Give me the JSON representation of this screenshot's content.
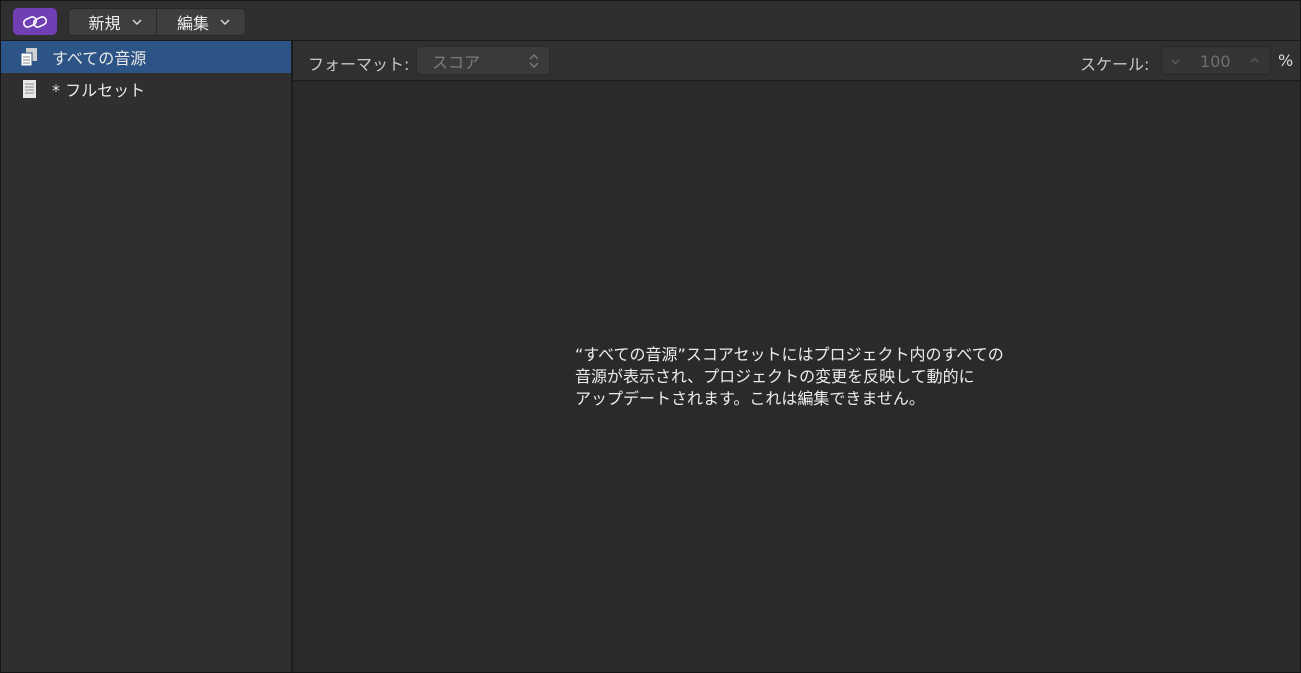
{
  "toolbar": {
    "link_icon": "link-icon",
    "new_label": "新規",
    "edit_label": "編集"
  },
  "sidebar": {
    "items": [
      {
        "label": "すべての音源",
        "icon": "instrument-set-icon",
        "selected": true
      },
      {
        "label": "* フルセット",
        "icon": "score-set-icon",
        "selected": false
      }
    ]
  },
  "header": {
    "format_label": "フォーマット:",
    "format_value": "スコア",
    "scale_label": "スケール:",
    "scale_value": "100",
    "scale_unit": "%"
  },
  "main": {
    "message_lines": [
      "“すべての音源”スコアセットにはプロジェクト内のすべての",
      "音源が表示され、プロジェクトの変更を反映して動的に",
      "アップデートされます。これは編集できません。"
    ]
  },
  "colors": {
    "accent_link_button": "#6f3fb3",
    "selection": "#2d5487",
    "background": "#2a2a2a"
  }
}
